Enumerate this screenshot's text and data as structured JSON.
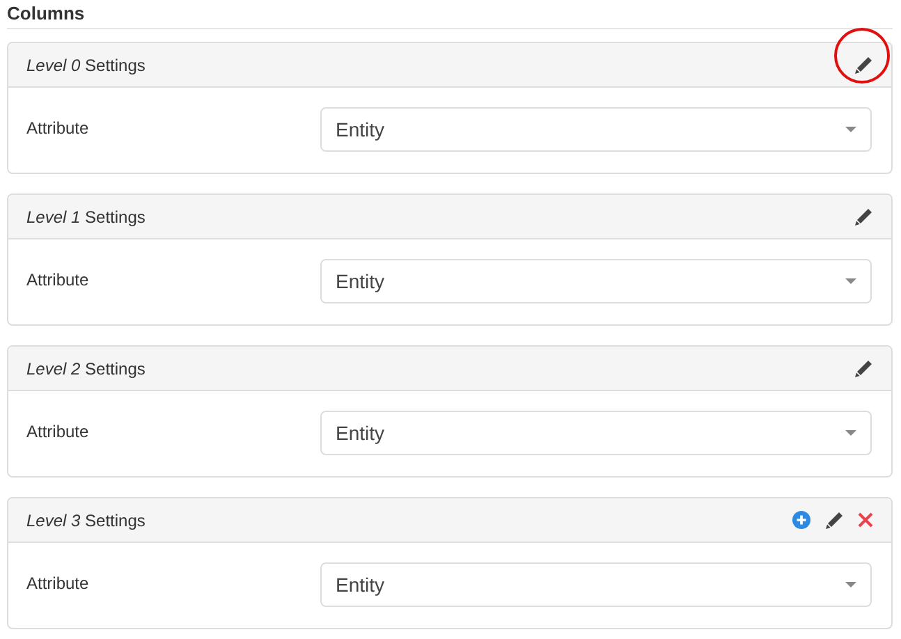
{
  "heading": "Columns",
  "panels": [
    {
      "level": "Level 0",
      "title": "Settings",
      "highlighted": true,
      "actions": [
        {
          "kind": "edit"
        }
      ],
      "field_label": "Attribute",
      "value": "Entity"
    },
    {
      "level": "Level 1",
      "title": "Settings",
      "highlighted": false,
      "actions": [
        {
          "kind": "edit"
        }
      ],
      "field_label": "Attribute",
      "value": "Entity"
    },
    {
      "level": "Level 2",
      "title": "Settings",
      "highlighted": false,
      "actions": [
        {
          "kind": "edit"
        }
      ],
      "field_label": "Attribute",
      "value": "Entity"
    },
    {
      "level": "Level 3",
      "title": "Settings",
      "highlighted": false,
      "actions": [
        {
          "kind": "add"
        },
        {
          "kind": "edit"
        },
        {
          "kind": "delete"
        }
      ],
      "field_label": "Attribute",
      "value": "Entity"
    }
  ]
}
